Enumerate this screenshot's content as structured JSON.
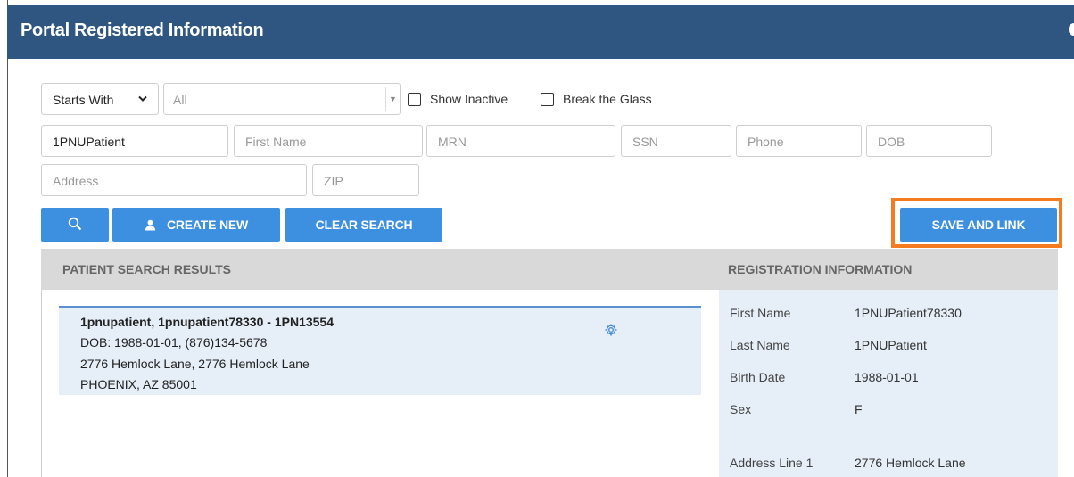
{
  "header": {
    "title": "Portal Registered Information"
  },
  "search": {
    "match_mode": "Starts With",
    "scope": "All",
    "show_inactive_label": "Show Inactive",
    "break_glass_label": "Break the Glass",
    "last_name_value": "1PNUPatient",
    "first_name_placeholder": "First Name",
    "mrn_placeholder": "MRN",
    "ssn_placeholder": "SSN",
    "phone_placeholder": "Phone",
    "dob_placeholder": "DOB",
    "address_placeholder": "Address",
    "zip_placeholder": "ZIP"
  },
  "buttons": {
    "create_new": "CREATE NEW",
    "clear_search": "CLEAR SEARCH",
    "save_and_link": "SAVE AND LINK"
  },
  "results": {
    "header_left": "PATIENT SEARCH RESULTS",
    "header_right": "REGISTRATION INFORMATION",
    "items": [
      {
        "name": "1pnupatient, 1pnupatient78330 - 1PN13554",
        "dob_phone": "DOB: 1988-01-01, (876)134-5678",
        "address": "2776 Hemlock Lane, 2776 Hemlock Lane",
        "city": "PHOENIX, AZ 85001"
      }
    ]
  },
  "registration": {
    "first_name_label": "First Name",
    "first_name": "1PNUPatient78330",
    "last_name_label": "Last Name",
    "last_name": "1PNUPatient",
    "birth_date_label": "Birth Date",
    "birth_date": "1988-01-01",
    "sex_label": "Sex",
    "sex": "F",
    "address1_label": "Address Line 1",
    "address1": "2776 Hemlock Lane"
  },
  "colors": {
    "header_bg": "#2e5681",
    "button_bg": "#3d8fe0",
    "highlight": "#f47b20",
    "panel_bg": "#e6eef7"
  }
}
